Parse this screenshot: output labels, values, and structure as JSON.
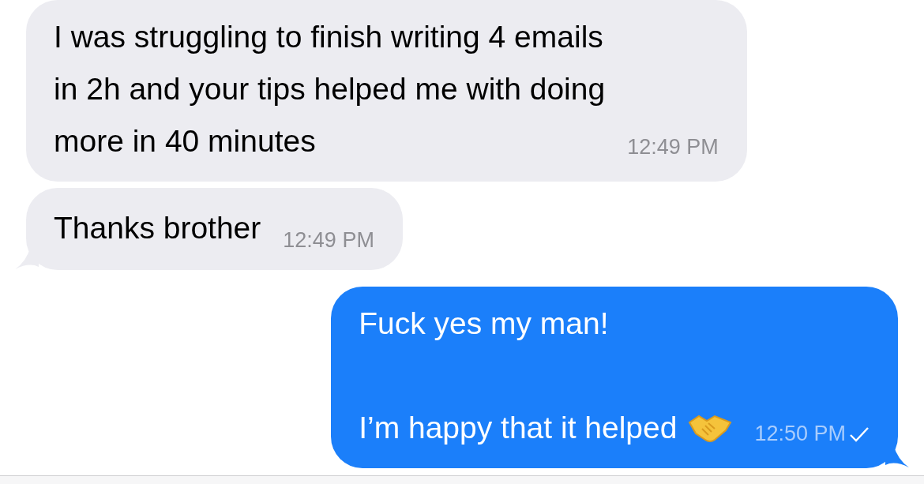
{
  "messages": [
    {
      "kind": "incoming",
      "paragraphs": [
        [
          "I was struggling to finish writing 4 emails",
          "in 2h and your tips helped me with doing",
          "more in 40 minutes"
        ]
      ],
      "time": "12:49 PM",
      "tail": false
    },
    {
      "kind": "incoming",
      "paragraphs": [
        [
          "Thanks brother"
        ]
      ],
      "time": "12:49 PM",
      "tail": true
    },
    {
      "kind": "outgoing",
      "paragraphs": [
        [
          "Fuck yes my man!"
        ],
        [
          "I’m happy that it helped"
        ]
      ],
      "with_icon": true,
      "time": "12:50 PM",
      "tail": true,
      "read": true
    }
  ]
}
